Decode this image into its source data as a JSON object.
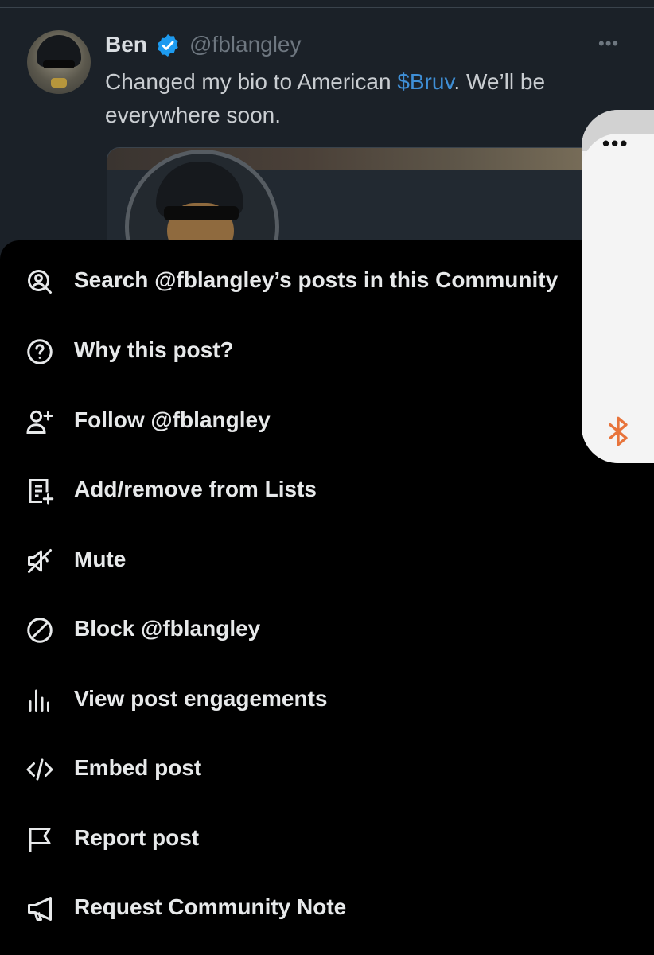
{
  "tweet": {
    "name": "Ben",
    "handle": "@fblangley",
    "text_before": "Changed my bio to American ",
    "cashtag": "$Bruv",
    "text_after": ". We’ll be everywhere soon.",
    "more_icon": "more-horizontal-icon",
    "verified_icon": "verified-badge-icon",
    "cashtag_color": "#3f8fd6"
  },
  "menu": {
    "items": [
      {
        "label": "Search @fblangley’s posts in this Community",
        "icon": "user-search-icon"
      },
      {
        "label": "Why this post?",
        "icon": "question-circle-icon"
      },
      {
        "label": "Follow @fblangley",
        "icon": "user-plus-icon"
      },
      {
        "label": "Add/remove from Lists",
        "icon": "list-add-icon"
      },
      {
        "label": "Mute",
        "icon": "speaker-mute-icon"
      },
      {
        "label": "Block @fblangley",
        "icon": "block-icon"
      },
      {
        "label": "View post engagements",
        "icon": "bar-chart-icon"
      },
      {
        "label": "Embed post",
        "icon": "code-icon"
      },
      {
        "label": "Report post",
        "icon": "flag-icon"
      },
      {
        "label": "Request Community Note",
        "icon": "megaphone-icon"
      }
    ]
  },
  "side_pill": {
    "more_icon": "more-dots-icon",
    "bluetooth_icon": "bluetooth-icon",
    "bluetooth_color": "#e8743b"
  }
}
